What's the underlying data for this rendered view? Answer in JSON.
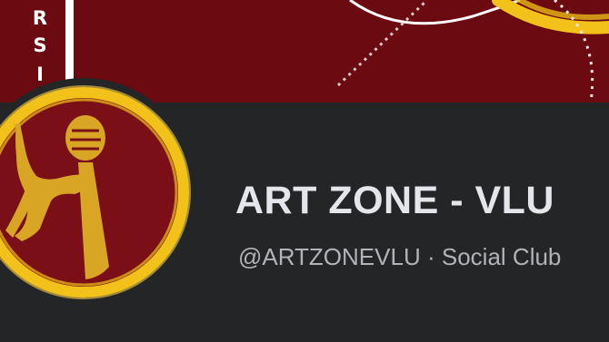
{
  "cover": {
    "letters": [
      "R",
      "S",
      "I"
    ],
    "background_color": "#6c0a12",
    "ring_color": "#f2c21b"
  },
  "profile": {
    "avatar_icon": "dancer-microphone-logo-icon",
    "ring_color": "#f2c21b",
    "fill_color": "#7a0f18",
    "figure_color": "#d9a524"
  },
  "page": {
    "name": "ART ZONE - VLU",
    "handle": "@ARTZONEVLU",
    "separator": "·",
    "category": "Social Club"
  },
  "colors": {
    "header_background": "#242526",
    "title_text": "#e4e6eb",
    "meta_text": "#b0b3b8"
  }
}
